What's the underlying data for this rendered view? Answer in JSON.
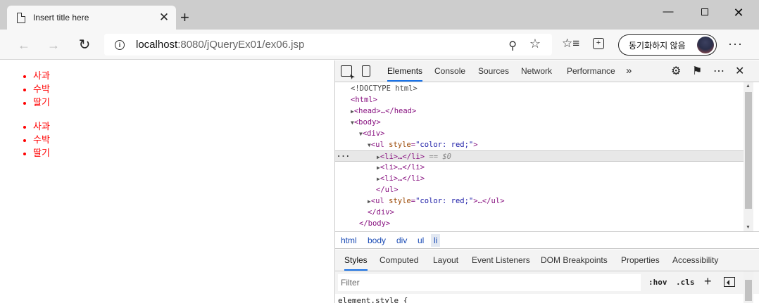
{
  "browser": {
    "tab_title": "Insert title here",
    "tab_close": "✕",
    "new_tab": "+",
    "url_host": "localhost",
    "url_path": ":8080/jQueryEx01/ex06.jsp",
    "profile_label": "동기화하지 않음",
    "more": "···"
  },
  "page": {
    "list1": [
      "사과",
      "수박",
      "딸기"
    ],
    "list2": [
      "사과",
      "수박",
      "딸기"
    ],
    "list_color": "#ff0000"
  },
  "devtools": {
    "tabs": [
      "Elements",
      "Console",
      "Sources",
      "Network",
      "Performance"
    ],
    "active_tab": "Elements",
    "more_tabs": "»",
    "dom": {
      "doctype": "<!DOCTYPE html>",
      "html_open": "<html>",
      "head": "<head>…</head>",
      "body_open": "<body>",
      "div_open": "<div>",
      "ul_open_tag": "ul",
      "ul_attr_name": "style",
      "ul_attr_value": "\"color: red;\"",
      "li_collapsed": "<li>…</li>",
      "selected_suffix": " == $0",
      "ul_close": "</ul>",
      "ul2_suffix": ">…</ul>",
      "div_close": "</div>",
      "body_close": "</body>",
      "dots": "···"
    },
    "breadcrumbs": [
      "html",
      "body",
      "div",
      "ul",
      "li"
    ],
    "active_crumb": "li",
    "styles_tabs": [
      "Styles",
      "Computed",
      "Layout",
      "Event Listeners",
      "DOM Breakpoints",
      "Properties",
      "Accessibility"
    ],
    "active_styles_tab": "Styles",
    "filter_placeholder": "Filter",
    "hov": ":hov",
    "cls": ".cls",
    "element_style": "element.style {"
  }
}
